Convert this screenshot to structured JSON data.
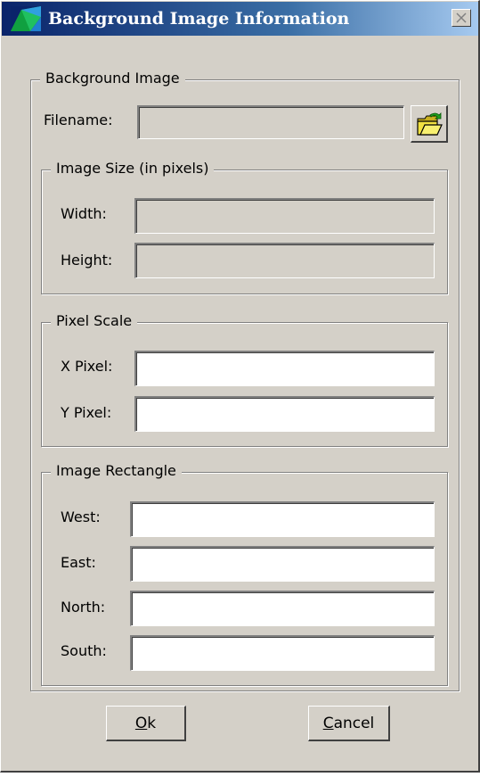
{
  "window": {
    "title": "Background Image Information"
  },
  "background_image": {
    "legend": "Background Image",
    "filename_label": "Filename:",
    "filename_value": ""
  },
  "image_size": {
    "legend": "Image Size (in pixels)",
    "width_label": "Width:",
    "width_value": "",
    "height_label": "Height:",
    "height_value": ""
  },
  "pixel_scale": {
    "legend": "Pixel Scale",
    "x_label": "X Pixel:",
    "x_value": "",
    "y_label": "Y Pixel:",
    "y_value": ""
  },
  "image_rectangle": {
    "legend": "Image Rectangle",
    "west_label": "West:",
    "west_value": "",
    "east_label": "East:",
    "east_value": "",
    "north_label": "North:",
    "north_value": "",
    "south_label": "South:",
    "south_value": ""
  },
  "buttons": {
    "ok_mnemonic": "O",
    "ok_rest": "k",
    "cancel_mnemonic": "C",
    "cancel_rest": "ancel"
  },
  "icons": {
    "app": "app-icon",
    "close": "close-icon",
    "browse": "open-folder-icon"
  },
  "colors": {
    "title_gradient_start": "#0a246a",
    "title_gradient_end": "#a6caf0",
    "dialog_face": "#d4d0c8",
    "folder_yellow": "#f0e040"
  }
}
